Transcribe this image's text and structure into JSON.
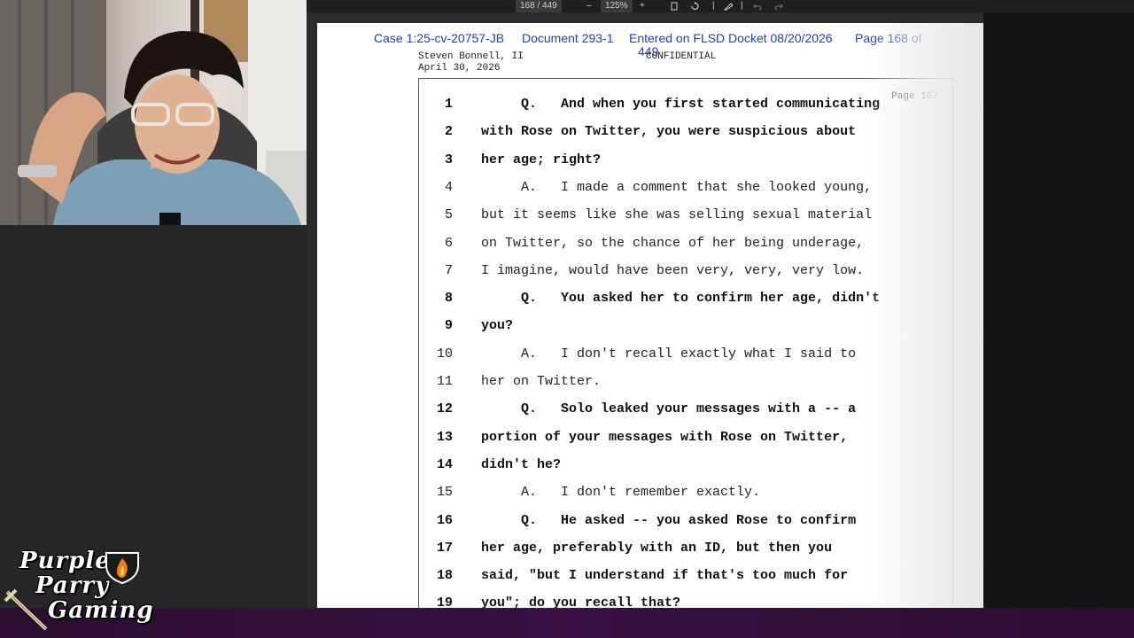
{
  "toolbar": {
    "page_indicator": "168 / 449",
    "zoom_out": "–",
    "zoom_level": "125%",
    "zoom_in": "+"
  },
  "stamp": {
    "case": "Case 1:25-cv-20757-JB",
    "document": "Document 293-1",
    "entered": "Entered on FLSD Docket 08/20/2026",
    "page_of": "Page 168 of",
    "page_total": "449"
  },
  "header": {
    "deponent": "Steven Bonnell, II",
    "date": "April 30, 2026",
    "confidential": "CONFIDENTIAL",
    "page_label": "Page 167"
  },
  "transcript": [
    {
      "num": "1",
      "text": "     Q.   And when you first started communicating",
      "bold": true
    },
    {
      "num": "2",
      "text": "with Rose on Twitter, you were suspicious about",
      "bold": true
    },
    {
      "num": "3",
      "text": "her age; right?",
      "bold": true
    },
    {
      "num": "4",
      "text": "     A.   I made a comment that she looked young,",
      "bold": false
    },
    {
      "num": "5",
      "text": "but it seems like she was selling sexual material",
      "bold": false
    },
    {
      "num": "6",
      "text": "on Twitter, so the chance of her being underage,",
      "bold": false
    },
    {
      "num": "7",
      "text": "I imagine, would have been very, very, very low.",
      "bold": false
    },
    {
      "num": "8",
      "text": "     Q.   You asked her to confirm her age, didn't",
      "bold": true
    },
    {
      "num": "9",
      "text": "you?",
      "bold": true
    },
    {
      "num": "10",
      "text": "     A.   I don't recall exactly what I said to",
      "bold": false
    },
    {
      "num": "11",
      "text": "her on Twitter.",
      "bold": false
    },
    {
      "num": "12",
      "text": "     Q.   Solo leaked your messages with a -- a",
      "bold": true
    },
    {
      "num": "13",
      "text": "portion of your messages with Rose on Twitter,",
      "bold": true
    },
    {
      "num": "14",
      "text": "didn't he?",
      "bold": true
    },
    {
      "num": "15",
      "text": "     A.   I don't remember exactly.",
      "bold": false
    },
    {
      "num": "16",
      "text": "     Q.   He asked -- you asked Rose to confirm",
      "bold": true
    },
    {
      "num": "17",
      "text": "her age, preferably with an ID, but then you",
      "bold": true
    },
    {
      "num": "18",
      "text": "said, \"but I understand if that's too much for",
      "bold": true
    },
    {
      "num": "19",
      "text": "you\"; do you recall that?",
      "bold": true
    }
  ],
  "logo": {
    "line1": "Purple",
    "line2": "Parry",
    "line3": "Gaming"
  },
  "colors": {
    "stamp_blue": "#1f3fbf",
    "stream_bar": "#3b1145",
    "logo_flame": "#f07a1a"
  },
  "icons": [
    "fit-page-icon",
    "rotate-icon",
    "draw-icon",
    "undo-icon",
    "redo-icon",
    "flame-shield-icon",
    "crossed-swords-icon"
  ]
}
